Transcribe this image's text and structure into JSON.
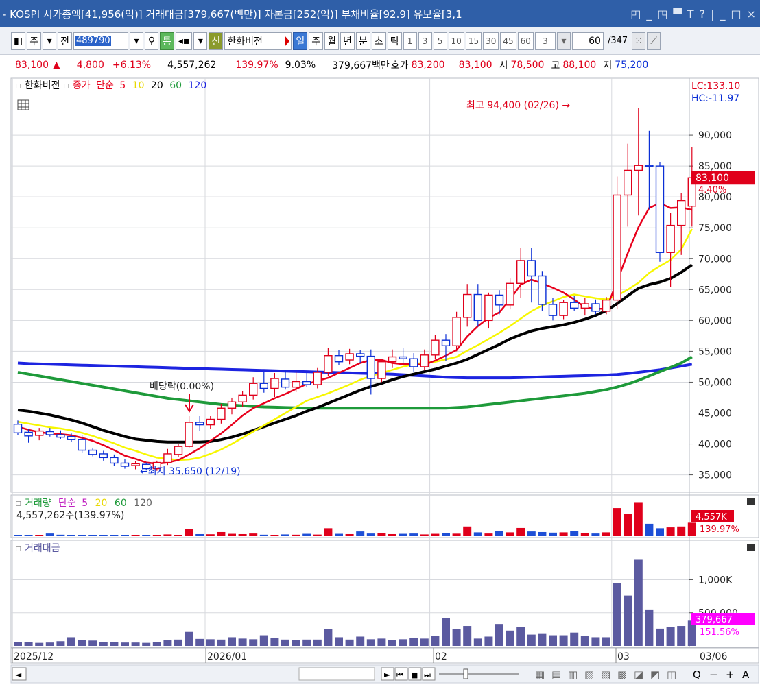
{
  "window": {
    "title": "- KOSPI 시가총액[41,956(억)] 거래대금[379,667(백만)] 자본금[252(억)] 부채비율[92.9] 유보율[3,1",
    "controls": [
      "◰",
      "_",
      "◳",
      "▀",
      "T",
      "?",
      "|",
      "_",
      "□",
      "×"
    ]
  },
  "toolbar": {
    "type_label": "주",
    "all_label": "전",
    "code": "489790",
    "tong_label": "통",
    "sin_label": "신",
    "stock_name": "한화비전",
    "period_buttons": [
      "일",
      "주",
      "월",
      "년",
      "분",
      "초",
      "틱"
    ],
    "selected_period": "일",
    "intervals": [
      "1",
      "3",
      "5",
      "10",
      "15",
      "30",
      "45",
      "60"
    ],
    "interval_value": "3",
    "count_value": "60",
    "count_total": "/347"
  },
  "quote": {
    "price": "83,100",
    "change_arrow": "▲",
    "change": "4,800",
    "change_pct": "+6.13%",
    "volume": "4,557,262",
    "volume_ratio": "139.97%",
    "turnover": "9.03%",
    "amount": "379,667백만",
    "bid_label": "호가",
    "bid1": "83,200",
    "bid2": "83,100",
    "open_label": "시",
    "open": "78,500",
    "high_label": "고",
    "high": "88,100",
    "low_label": "저",
    "low": "75,200"
  },
  "colors": {
    "up": "#e0001b",
    "down": "#0b2fd6",
    "ma5": "#e8001c",
    "ma10": "#f7f700",
    "ma20": "#000000",
    "ma60": "#1e9a3a",
    "ma120": "#1d24e0",
    "volume_bar_up": "#e0001b",
    "volume_bar_down": "#1e4fd6",
    "amount_bar": "#5b5aa0"
  },
  "chart_data": [
    {
      "type": "candlestick",
      "panel": "price",
      "legend": {
        "name": "한화비전",
        "close_label": "종가",
        "ma_label": "단순",
        "periods": [
          "5",
          "10",
          "20",
          "60",
          "120"
        ]
      },
      "lc": "LC:133.10",
      "hc": "HC:-11.97",
      "current_price": "83,100",
      "current_pct": "4.40%",
      "y_ticks": [
        "90,000",
        "85,000",
        "80,000",
        "75,000",
        "70,000",
        "65,000",
        "60,000",
        "55,000",
        "50,000",
        "45,000",
        "40,000",
        "35,000"
      ],
      "ylim": [
        32400,
        99000
      ],
      "annotations": {
        "high": "최고 94,400 (02/26) →",
        "low": "←최저 35,650 (12/19)",
        "dividend": "배당락(0.00%)"
      },
      "x_labels": [
        "2025/12",
        "2026/01",
        "02",
        "03",
        "03/06"
      ],
      "candles": [
        {
          "o": 43200,
          "h": 43800,
          "l": 41500,
          "c": 41800
        },
        {
          "o": 41900,
          "h": 42500,
          "l": 40200,
          "c": 41300
        },
        {
          "o": 41400,
          "h": 42600,
          "l": 40600,
          "c": 42100
        },
        {
          "o": 42000,
          "h": 42600,
          "l": 41200,
          "c": 41500
        },
        {
          "o": 41500,
          "h": 42200,
          "l": 40800,
          "c": 41100
        },
        {
          "o": 41200,
          "h": 41700,
          "l": 40300,
          "c": 40700
        },
        {
          "o": 40700,
          "h": 41400,
          "l": 38600,
          "c": 39000
        },
        {
          "o": 39000,
          "h": 39400,
          "l": 38000,
          "c": 38300
        },
        {
          "o": 38400,
          "h": 38900,
          "l": 37300,
          "c": 37800
        },
        {
          "o": 37800,
          "h": 38300,
          "l": 36500,
          "c": 36900
        },
        {
          "o": 36900,
          "h": 37500,
          "l": 36000,
          "c": 36400
        },
        {
          "o": 36500,
          "h": 37200,
          "l": 35900,
          "c": 36800
        },
        {
          "o": 36700,
          "h": 37000,
          "l": 35700,
          "c": 36000
        },
        {
          "o": 36000,
          "h": 37300,
          "l": 35650,
          "c": 37000
        },
        {
          "o": 37000,
          "h": 39200,
          "l": 36600,
          "c": 38400
        },
        {
          "o": 38300,
          "h": 40000,
          "l": 37900,
          "c": 39600
        },
        {
          "o": 39600,
          "h": 44500,
          "l": 39300,
          "c": 43500
        },
        {
          "o": 43500,
          "h": 44500,
          "l": 42100,
          "c": 43100
        },
        {
          "o": 43100,
          "h": 44500,
          "l": 42500,
          "c": 44000
        },
        {
          "o": 44000,
          "h": 46500,
          "l": 43300,
          "c": 45800
        },
        {
          "o": 45800,
          "h": 47500,
          "l": 44800,
          "c": 46800
        },
        {
          "o": 46800,
          "h": 48500,
          "l": 46000,
          "c": 47900
        },
        {
          "o": 47900,
          "h": 50800,
          "l": 47200,
          "c": 49800
        },
        {
          "o": 49800,
          "h": 51700,
          "l": 48300,
          "c": 49000
        },
        {
          "o": 49000,
          "h": 51500,
          "l": 47600,
          "c": 50600
        },
        {
          "o": 50500,
          "h": 52000,
          "l": 48800,
          "c": 49200
        },
        {
          "o": 49200,
          "h": 51600,
          "l": 48400,
          "c": 50100
        },
        {
          "o": 50100,
          "h": 51500,
          "l": 49200,
          "c": 49600
        },
        {
          "o": 49600,
          "h": 52300,
          "l": 49000,
          "c": 51600
        },
        {
          "o": 51600,
          "h": 55600,
          "l": 51000,
          "c": 54300
        },
        {
          "o": 54300,
          "h": 55200,
          "l": 52800,
          "c": 53300
        },
        {
          "o": 53600,
          "h": 55400,
          "l": 52900,
          "c": 54600
        },
        {
          "o": 54600,
          "h": 55200,
          "l": 53100,
          "c": 54200
        },
        {
          "o": 54200,
          "h": 55300,
          "l": 48000,
          "c": 50600
        },
        {
          "o": 50600,
          "h": 53400,
          "l": 50000,
          "c": 53300
        },
        {
          "o": 53300,
          "h": 55300,
          "l": 52300,
          "c": 54100
        },
        {
          "o": 54100,
          "h": 55500,
          "l": 53000,
          "c": 53800
        },
        {
          "o": 53800,
          "h": 54700,
          "l": 51700,
          "c": 52500
        },
        {
          "o": 52500,
          "h": 55300,
          "l": 51900,
          "c": 54400
        },
        {
          "o": 54400,
          "h": 57600,
          "l": 53800,
          "c": 56800
        },
        {
          "o": 56800,
          "h": 57800,
          "l": 53400,
          "c": 55900
        },
        {
          "o": 55900,
          "h": 61400,
          "l": 55000,
          "c": 60500
        },
        {
          "o": 60500,
          "h": 65900,
          "l": 59000,
          "c": 64200
        },
        {
          "o": 64200,
          "h": 65900,
          "l": 59000,
          "c": 60000
        },
        {
          "o": 60000,
          "h": 64500,
          "l": 58700,
          "c": 64100
        },
        {
          "o": 64100,
          "h": 64900,
          "l": 61000,
          "c": 62500
        },
        {
          "o": 62500,
          "h": 66800,
          "l": 61800,
          "c": 66000
        },
        {
          "o": 66000,
          "h": 71800,
          "l": 63600,
          "c": 69700
        },
        {
          "o": 69700,
          "h": 71800,
          "l": 62900,
          "c": 67200
        },
        {
          "o": 67200,
          "h": 68000,
          "l": 61600,
          "c": 62600
        },
        {
          "o": 62600,
          "h": 63600,
          "l": 60000,
          "c": 60800
        },
        {
          "o": 60800,
          "h": 63300,
          "l": 60200,
          "c": 62900
        },
        {
          "o": 62900,
          "h": 64000,
          "l": 61600,
          "c": 62000
        },
        {
          "o": 62000,
          "h": 63700,
          "l": 60800,
          "c": 62700
        },
        {
          "o": 62700,
          "h": 63400,
          "l": 61000,
          "c": 61500
        },
        {
          "o": 61500,
          "h": 63800,
          "l": 61000,
          "c": 63300
        },
        {
          "o": 63300,
          "h": 83300,
          "l": 61800,
          "c": 80300
        },
        {
          "o": 80300,
          "h": 88600,
          "l": 75200,
          "c": 84300
        },
        {
          "o": 84300,
          "h": 94400,
          "l": 77000,
          "c": 85100
        },
        {
          "o": 85100,
          "h": 90700,
          "l": 78000,
          "c": 85000
        },
        {
          "o": 85000,
          "h": 85600,
          "l": 69500,
          "c": 71000
        },
        {
          "o": 71000,
          "h": 77400,
          "l": 65400,
          "c": 75400
        },
        {
          "o": 75400,
          "h": 80600,
          "l": 70600,
          "c": 79400
        },
        {
          "o": 78500,
          "h": 88100,
          "l": 75200,
          "c": 83100
        }
      ],
      "series": [
        {
          "name": "5",
          "values": [
            42800,
            42300,
            41900,
            41700,
            41600,
            41400,
            41000,
            40500,
            39800,
            39000,
            38100,
            37600,
            37000,
            36800,
            37000,
            37400,
            38300,
            39300,
            40500,
            41700,
            43100,
            44600,
            45800,
            46600,
            47400,
            48100,
            48900,
            49700,
            50200,
            50700,
            51500,
            52300,
            53100,
            53600,
            53600,
            53100,
            52900,
            52900,
            52800,
            53500,
            54300,
            55200,
            57400,
            59100,
            60400,
            61300,
            63400,
            65800,
            66600,
            66000,
            65300,
            64500,
            63400,
            62100,
            61900,
            61900,
            66300,
            70900,
            75100,
            78200,
            79000,
            78200,
            78300,
            77900
          ]
        },
        {
          "name": "10",
          "values": [
            43600,
            43300,
            43000,
            42700,
            42500,
            42200,
            41800,
            41300,
            40700,
            40100,
            39400,
            38900,
            38300,
            37800,
            37600,
            37400,
            37500,
            37800,
            38400,
            39100,
            40000,
            41000,
            42000,
            43000,
            44000,
            45000,
            46000,
            47000,
            47600,
            48200,
            48900,
            49600,
            50400,
            51000,
            51500,
            52000,
            52500,
            52900,
            53200,
            53300,
            53700,
            54100,
            55100,
            56000,
            57000,
            58000,
            59100,
            60300,
            61500,
            62400,
            63100,
            63800,
            64200,
            63900,
            63600,
            63400,
            64000,
            65000,
            66100,
            67700,
            68800,
            69800,
            71500,
            74800
          ]
        },
        {
          "name": "20",
          "values": [
            45500,
            45300,
            45000,
            44700,
            44300,
            43900,
            43400,
            42800,
            42200,
            41700,
            41200,
            40800,
            40600,
            40400,
            40300,
            40300,
            40300,
            40300,
            40400,
            40700,
            41100,
            41600,
            42200,
            42800,
            43400,
            44000,
            44600,
            45300,
            45900,
            46600,
            47300,
            48000,
            48700,
            49300,
            49800,
            50400,
            50900,
            51300,
            51700,
            52100,
            52600,
            53100,
            53700,
            54500,
            55300,
            56100,
            57000,
            57700,
            58300,
            58700,
            59000,
            59300,
            59700,
            60200,
            60800,
            61600,
            62700,
            64000,
            65200,
            65800,
            66200,
            66800,
            67800,
            69000
          ]
        },
        {
          "name": "60",
          "values": [
            51600,
            51300,
            51000,
            50700,
            50400,
            50100,
            49800,
            49500,
            49200,
            48900,
            48600,
            48300,
            48000,
            47700,
            47400,
            47200,
            47000,
            46800,
            46600,
            46400,
            46300,
            46200,
            46100,
            46000,
            45950,
            45900,
            45850,
            45800,
            45800,
            45800,
            45800,
            45800,
            45800,
            45800,
            45800,
            45800,
            45800,
            45800,
            45800,
            45800,
            45800,
            45900,
            46000,
            46200,
            46400,
            46600,
            46800,
            47000,
            47200,
            47400,
            47600,
            47800,
            48000,
            48200,
            48500,
            48800,
            49200,
            49700,
            50300,
            51000,
            51700,
            52400,
            53100,
            54100
          ]
        },
        {
          "name": "120",
          "values": [
            53100,
            53000,
            52950,
            52900,
            52850,
            52800,
            52750,
            52700,
            52650,
            52600,
            52550,
            52500,
            52450,
            52400,
            52350,
            52300,
            52250,
            52200,
            52150,
            52100,
            52050,
            52000,
            51950,
            51900,
            51850,
            51800,
            51750,
            51700,
            51650,
            51600,
            51550,
            51500,
            51450,
            51400,
            51350,
            51300,
            51200,
            51100,
            51000,
            50900,
            50800,
            50750,
            50700,
            50700,
            50700,
            50700,
            50700,
            50750,
            50800,
            50850,
            50900,
            50950,
            51000,
            51050,
            51100,
            51150,
            51250,
            51400,
            51600,
            51800,
            52000,
            52300,
            52600,
            52900
          ]
        }
      ]
    },
    {
      "type": "bar",
      "panel": "volume",
      "legend": {
        "name": "거래량",
        "ma_label": "단순",
        "periods": [
          "5",
          "20",
          "60",
          "120"
        ]
      },
      "value_label": "4,557,262주(139.97%)",
      "current": "4,557K",
      "current_pct": "139.97%",
      "values": [
        300,
        350,
        320,
        900,
        500,
        420,
        380,
        330,
        340,
        300,
        310,
        290,
        280,
        350,
        600,
        400,
        2500,
        700,
        650,
        1400,
        800,
        700,
        900,
        500,
        450,
        600,
        500,
        800,
        550,
        2700,
        800,
        700,
        1600,
        900,
        1000,
        700,
        800,
        900,
        600,
        800,
        1100,
        850,
        3300,
        1300,
        900,
        1700,
        1300,
        2800,
        1600,
        1400,
        1200,
        1300,
        1700,
        1100,
        900,
        1300,
        9500,
        7500,
        11500,
        4200,
        2700,
        3000,
        3300,
        4557
      ],
      "ylim": [
        0,
        13000
      ]
    },
    {
      "type": "bar",
      "panel": "amount",
      "legend": {
        "name": "거래대금"
      },
      "y_ticks": [
        "1,000K",
        "500,000"
      ],
      "current": "379,667",
      "current_pct": "151.56%",
      "values": [
        60,
        55,
        45,
        50,
        70,
        130,
        90,
        80,
        60,
        55,
        50,
        50,
        45,
        55,
        90,
        95,
        210,
        105,
        100,
        95,
        130,
        110,
        100,
        160,
        120,
        95,
        85,
        95,
        95,
        250,
        130,
        95,
        140,
        100,
        110,
        90,
        100,
        120,
        110,
        150,
        420,
        250,
        300,
        110,
        140,
        330,
        230,
        280,
        170,
        190,
        160,
        160,
        200,
        150,
        130,
        130,
        950,
        760,
        1300,
        550,
        260,
        290,
        300,
        380
      ],
      "ylim": [
        0,
        1450
      ]
    }
  ],
  "scrollbar": {
    "buttons": [
      "◄",
      "►",
      "⏮",
      "■",
      "⏭"
    ],
    "zoom_icons": [
      "zoom-out-icon",
      "zoom-in-icon"
    ],
    "tool_labels": [
      "Q",
      "−",
      "+",
      "A"
    ]
  }
}
